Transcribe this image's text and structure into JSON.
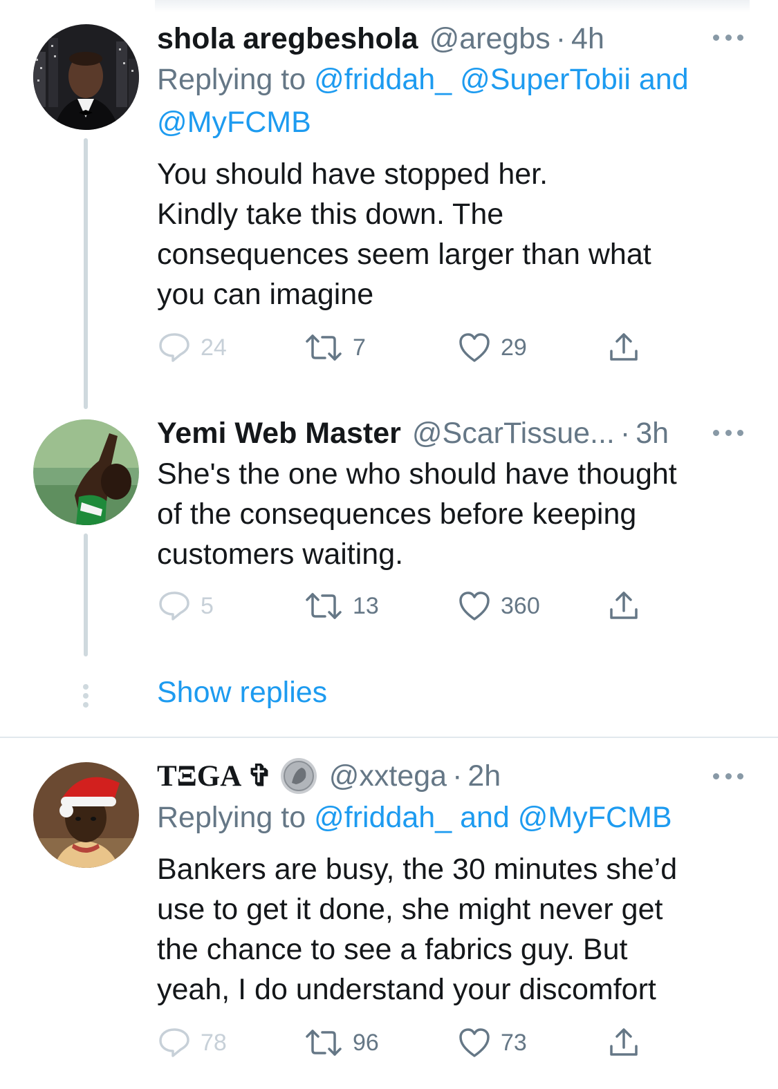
{
  "tweets": [
    {
      "name": "shola aregbeshola",
      "handle": "@aregbs",
      "time": "4h",
      "reply_prefix": "Replying to",
      "reply_mentions": "@friddah_ @SuperTobii and",
      "reply_mentions_2": "@MyFCMB",
      "body_lines": [
        "You should have stopped her.",
        "Kindly take this down. The",
        "consequences seem larger than what",
        "you can imagine"
      ],
      "replies": "24",
      "retweets": "7",
      "likes": "29"
    },
    {
      "name": "Yemi Web Master",
      "handle": "@ScarTissue...",
      "time": "3h",
      "body_lines": [
        "She's the one who should have thought",
        "of the consequences before keeping",
        "customers waiting."
      ],
      "replies": "5",
      "retweets": "13",
      "likes": "360"
    },
    {
      "name": "TΞGA ✞",
      "handle": "@xxtega",
      "time": "2h",
      "reply_prefix": "Replying to",
      "reply_mentions": "@friddah_ and @MyFCMB",
      "body_lines": [
        "Bankers are busy, the 30 minutes she’d",
        "use to get it done, she might never get",
        "the chance to see a fabrics guy. But",
        "yeah, I do understand your discomfort"
      ],
      "replies": "78",
      "retweets": "96",
      "likes": "73"
    }
  ],
  "show_replies": "Show replies",
  "separator_dot": "·",
  "icons": {
    "reply": "reply-icon",
    "retweet": "retweet-icon",
    "like": "heart-icon",
    "share": "share-icon",
    "more": "more-icon"
  },
  "colors": {
    "link": "#1d9bf0",
    "secondary": "#657786",
    "thread_line": "#cfd9de"
  }
}
